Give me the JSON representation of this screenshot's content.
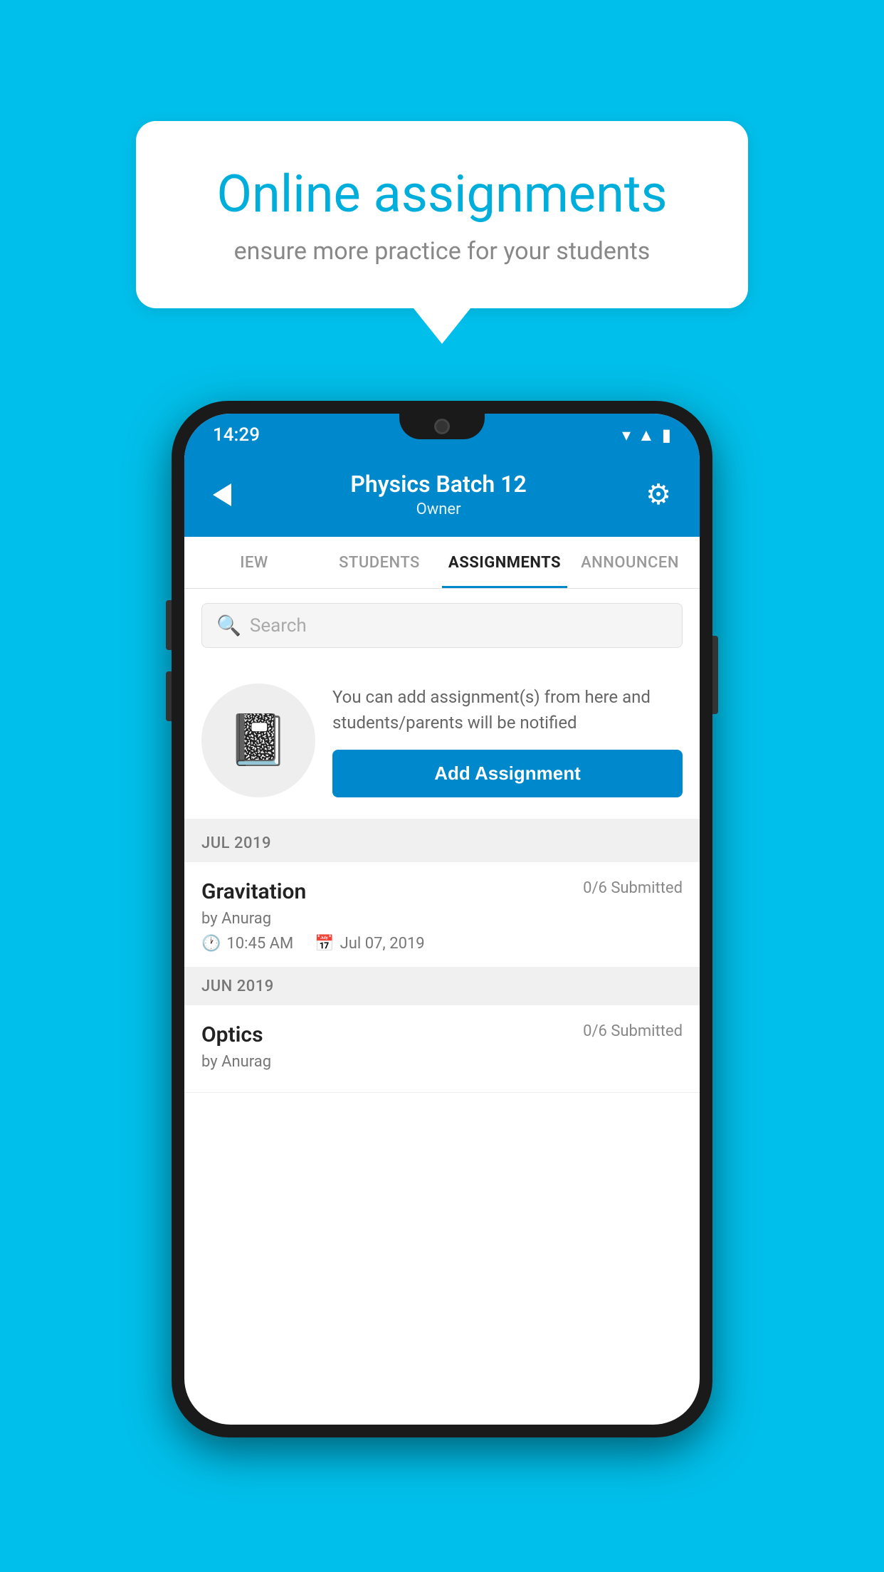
{
  "background_color": "#00BFEA",
  "speech_bubble": {
    "title": "Online assignments",
    "subtitle": "ensure more practice for your students"
  },
  "phone": {
    "status_bar": {
      "time": "14:29"
    },
    "top_bar": {
      "title": "Physics Batch 12",
      "subtitle": "Owner",
      "back_label": "←",
      "settings_label": "⚙"
    },
    "tabs": [
      {
        "label": "IEW",
        "active": false
      },
      {
        "label": "STUDENTS",
        "active": false
      },
      {
        "label": "ASSIGNMENTS",
        "active": true
      },
      {
        "label": "ANNOUNCEN",
        "active": false
      }
    ],
    "search": {
      "placeholder": "Search"
    },
    "promo": {
      "text": "You can add assignment(s) from here and students/parents will be notified",
      "button_label": "Add Assignment"
    },
    "sections": [
      {
        "header": "JUL 2019",
        "assignments": [
          {
            "title": "Gravitation",
            "submitted": "0/6 Submitted",
            "author": "by Anurag",
            "time": "10:45 AM",
            "date": "Jul 07, 2019"
          }
        ]
      },
      {
        "header": "JUN 2019",
        "assignments": [
          {
            "title": "Optics",
            "submitted": "0/6 Submitted",
            "author": "by Anurag",
            "time": "",
            "date": ""
          }
        ]
      }
    ]
  }
}
